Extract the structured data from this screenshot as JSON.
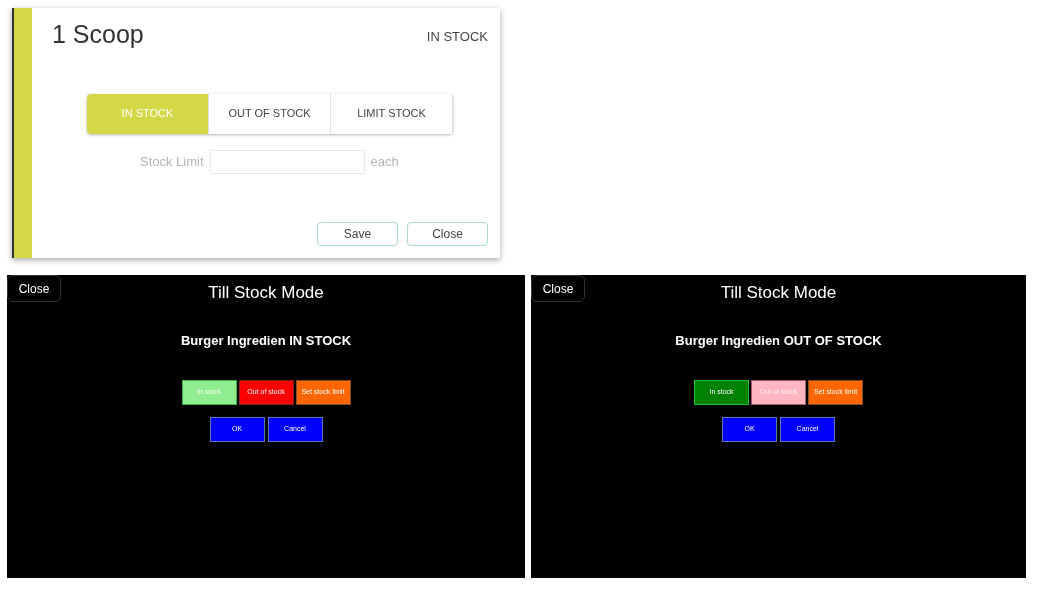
{
  "stock_card": {
    "title": "1 Scoop",
    "status": "IN STOCK",
    "options": [
      {
        "label": "IN STOCK",
        "selected": true
      },
      {
        "label": "OUT OF STOCK",
        "selected": false
      },
      {
        "label": "LIMIT STOCK",
        "selected": false
      }
    ],
    "stock_limit": {
      "label": "Stock Limit",
      "unit": "each",
      "disabled": true
    },
    "buttons": [
      "Save",
      "Close"
    ]
  },
  "till_screens": [
    {
      "close": "Close",
      "title": "Till Stock Mode",
      "heading": "Burger Ingredien IN STOCK",
      "options": [
        {
          "kind": "in",
          "label": "In stock",
          "selected": true
        },
        {
          "kind": "out",
          "label": "Out of stock",
          "selected": false
        },
        {
          "kind": "limit",
          "label": "Set stock limit",
          "selected": false
        }
      ],
      "buttons": [
        "OK",
        "Cancel"
      ]
    },
    {
      "close": "Close",
      "title": "Till Stock Mode",
      "heading": "Burger Ingredien OUT OF STOCK",
      "options": [
        {
          "kind": "in",
          "label": "In stock",
          "selected": false
        },
        {
          "kind": "out",
          "label": "Out of stock",
          "selected": true
        },
        {
          "kind": "limit",
          "label": "Set stock limit",
          "selected": false
        }
      ],
      "buttons": [
        "OK",
        "Cancel"
      ]
    }
  ]
}
